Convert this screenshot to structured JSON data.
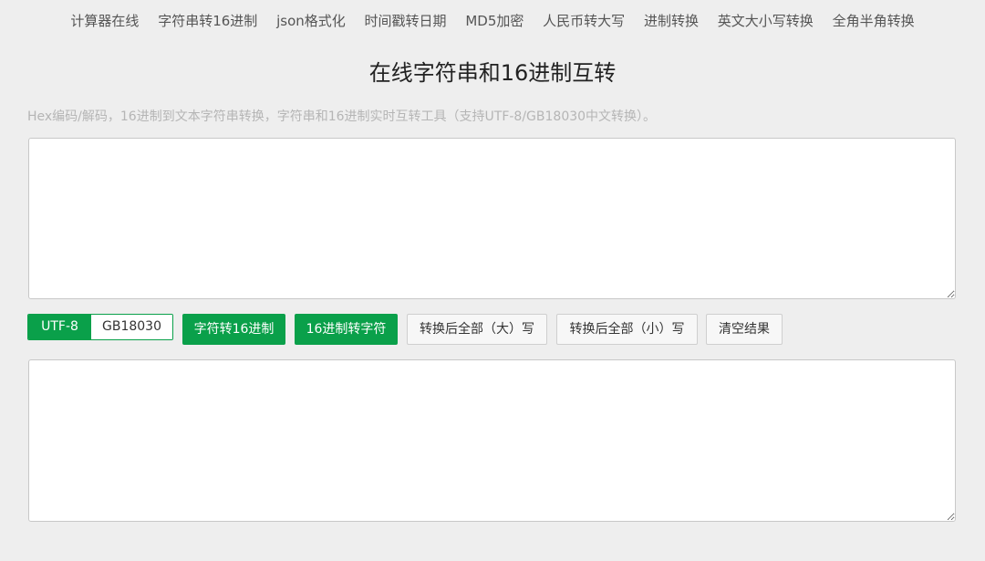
{
  "nav": {
    "items": [
      {
        "label": "计算器在线"
      },
      {
        "label": "字符串转16进制"
      },
      {
        "label": "json格式化"
      },
      {
        "label": "时间戳转日期"
      },
      {
        "label": "MD5加密"
      },
      {
        "label": "人民币转大写"
      },
      {
        "label": "进制转换"
      },
      {
        "label": "英文大小写转换"
      },
      {
        "label": "全角半角转换"
      }
    ]
  },
  "main": {
    "title": "在线字符串和16进制互转",
    "description": "Hex编码/解码，16进制到文本字符串转换，字符串和16进制实时互转工具（支持UTF-8/GB18030中文转换）。",
    "input_value": "",
    "output_value": ""
  },
  "encoding": {
    "selected": "UTF-8",
    "options": [
      "UTF-8",
      "GB18030"
    ]
  },
  "toolbar": {
    "str_to_hex_label": "字符转16进制",
    "hex_to_str_label": "16进制转字符",
    "to_upper_label": "转换后全部（大）写",
    "to_lower_label": "转换后全部（小）写",
    "clear_label": "清空结果"
  },
  "colors": {
    "accent": "#0aa04a",
    "background": "#eeeeee",
    "muted_text": "#b5b5b5"
  }
}
